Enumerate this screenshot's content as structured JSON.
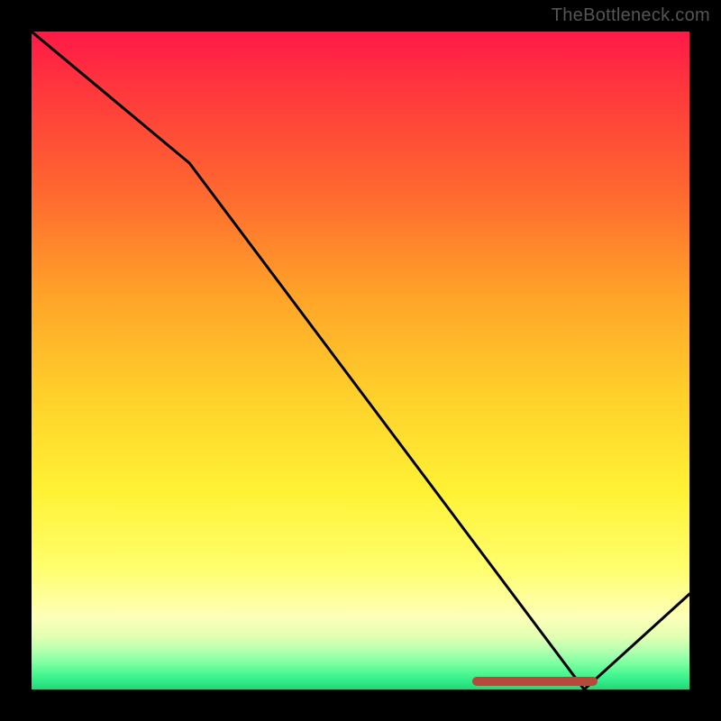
{
  "watermark": "TheBottleneck.com",
  "colors": {
    "line": "#000000",
    "baseline_cap": "#b54a3a",
    "background": "#000000",
    "gradient_top": "#ff1947",
    "gradient_bottom": "#1ed879"
  },
  "chart_data": {
    "type": "line",
    "title": "",
    "xlabel": "",
    "ylabel": "",
    "xlim": [
      0,
      100
    ],
    "ylim": [
      0,
      100
    ],
    "grid": false,
    "legend": false,
    "x": [
      0,
      24,
      84,
      100
    ],
    "y": [
      100,
      80,
      0,
      14.5
    ],
    "note": "x/y in percent of plot area; line descends from top-left, slope steepens at x≈24, hits bottom near x≈84, then rises to the right edge.",
    "baseline_segment": {
      "x_start": 67,
      "x_end": 86,
      "y": 0.6
    }
  }
}
